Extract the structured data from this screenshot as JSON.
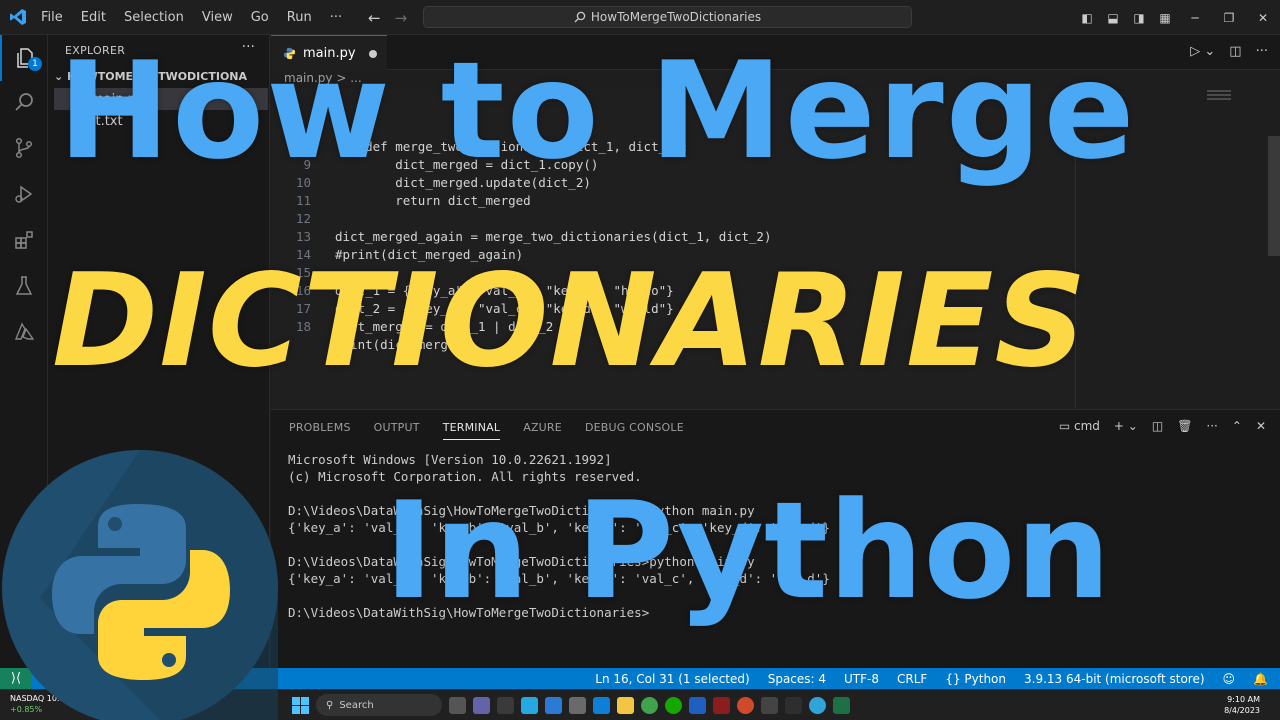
{
  "titlebar": {
    "menu": [
      "File",
      "Edit",
      "Selection",
      "View",
      "Go",
      "Run",
      "···"
    ],
    "search_text": "HowToMergeTwoDictionaries"
  },
  "activity": {
    "badge": "1"
  },
  "sidebar": {
    "header": "EXPLORER",
    "more": "···",
    "folder": "HOWTOMERGETWODICTIONA",
    "files": [
      {
        "name": "main.py",
        "selected": true
      },
      {
        "name": "pt.txt",
        "selected": false
      }
    ]
  },
  "editor": {
    "tab_label": "main.py",
    "breadcrumb": "main.py > ...",
    "lines": [
      {
        "num": "",
        "text": "    def merge_two_dictionaries(dict_1, dict_2):"
      },
      {
        "num": "",
        "text": "        dict_merged = dict_1.copy()"
      },
      {
        "num": "9",
        "text": "        dict_merged.update(dict_2)"
      },
      {
        "num": "10",
        "text": "        return dict_merged"
      },
      {
        "num": "11",
        "text": ""
      },
      {
        "num": "12",
        "text": "dict_merged_again = merge_two_dictionaries(dict_1, dict_2)"
      },
      {
        "num": "13",
        "text": "#print(dict_merged_again)"
      },
      {
        "num": "14",
        "text": ""
      },
      {
        "num": "15",
        "text": "dict_1 = {\"key_a\": \"val_a\", \"key_b\": \"hello\"}"
      },
      {
        "num": "16",
        "text": "dict_2 = {\"key_c\": \"val_c\", \"key_d\": \"world\"}"
      },
      {
        "num": "17",
        "text": "dict_merged = dict_1 | dict_2"
      },
      {
        "num": "18",
        "text": "print(dict_merged)"
      }
    ]
  },
  "panel": {
    "tabs": [
      "PROBLEMS",
      "OUTPUT",
      "TERMINAL",
      "AZURE",
      "DEBUG CONSOLE"
    ],
    "active_tab": "TERMINAL",
    "shell": "cmd",
    "terminal_lines": [
      "Microsoft Windows [Version 10.0.22621.1992]",
      "(c) Microsoft Corporation. All rights reserved.",
      "",
      "D:\\Videos\\DataWithSig\\HowToMergeTwoDictionaries>python main.py",
      "{'key_a': 'val_a', 'key_b': 'val_b', 'key_c': 'val_c', 'key_d': 'val_d'}",
      "",
      "D:\\Videos\\DataWithSig\\HowToMergeTwoDictionaries>python main.py",
      "{'key_a': 'val_a', 'key_b': 'val_b', 'key_c': 'val_c', 'key_d': 'val_d'}",
      "",
      "D:\\Videos\\DataWithSig\\HowToMergeTwoDictionaries>"
    ]
  },
  "statusbar": {
    "items": [
      "Ln 16, Col 31 (1 selected)",
      "Spaces: 4",
      "UTF-8",
      "CRLF",
      "{} Python",
      "3.9.13 64-bit (microsoft store)"
    ]
  },
  "taskbar": {
    "ticker_name": "NASDAQ 10...",
    "ticker_change": "+0.85%",
    "search_label": "Search",
    "time": "9:10 AM",
    "date": "8/4/2023"
  },
  "overlay": {
    "line1": "How to Merge",
    "line2": "DICTIONARIES",
    "line3": "In Python"
  },
  "colors": {
    "accent": "#007acc",
    "overlay_blue": "#4aa8f5",
    "overlay_yellow": "#fdd845",
    "python_blue": "#3772a4",
    "python_yellow": "#ffd43b"
  }
}
